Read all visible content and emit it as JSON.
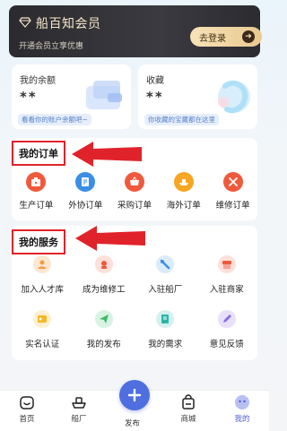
{
  "vip": {
    "title": "船百知会员",
    "subtitle": "开通会员立享优惠",
    "login_label": "去登录",
    "login_arrow": "➜"
  },
  "balance": {
    "label": "我的余额",
    "value": "**",
    "hint": "看看你的账户余额吧~"
  },
  "favorites": {
    "label": "收藏",
    "value": "**",
    "hint": "你收藏的宝藏都在这里"
  },
  "orders": {
    "title": "我的订单",
    "items": [
      {
        "label": "生产订单",
        "icon": "production-order-icon",
        "color": "#f05a3c"
      },
      {
        "label": "外协订单",
        "icon": "outsourcing-order-icon",
        "color": "#3a8ee6"
      },
      {
        "label": "采购订单",
        "icon": "purchase-order-icon",
        "color": "#f05a3c"
      },
      {
        "label": "海外订单",
        "icon": "overseas-order-icon",
        "color": "#f6a623"
      },
      {
        "label": "维修订单",
        "icon": "repair-order-icon",
        "color": "#f05a3c"
      }
    ]
  },
  "services": {
    "title": "我的服务",
    "row1": [
      {
        "label": "加入人才库",
        "icon": "talent-pool-icon",
        "color": "#f59a3e"
      },
      {
        "label": "成为维修工",
        "icon": "repair-worker-icon",
        "color": "#f05a3c"
      },
      {
        "label": "入驻船厂",
        "icon": "shipyard-icon",
        "color": "#3a8ee6"
      },
      {
        "label": "入驻商家",
        "icon": "merchant-icon",
        "color": "#f05a3c"
      }
    ],
    "row2": [
      {
        "label": "实名认证",
        "icon": "verification-icon",
        "color": "#f6b623"
      },
      {
        "label": "我的发布",
        "icon": "my-posts-icon",
        "color": "#3cba6a"
      },
      {
        "label": "我的需求",
        "icon": "my-needs-icon",
        "color": "#2bb5a8"
      },
      {
        "label": "意见反馈",
        "icon": "feedback-icon",
        "color": "#8a6ae6"
      }
    ]
  },
  "tabbar": {
    "home": "首页",
    "shipyard": "船厂",
    "publish": "发布",
    "mall": "商城",
    "mine": "我的"
  },
  "colors": {
    "accent": "#4f6fe0",
    "annotation_red": "#e0232a",
    "vip_gold": "#f5e6c8"
  }
}
